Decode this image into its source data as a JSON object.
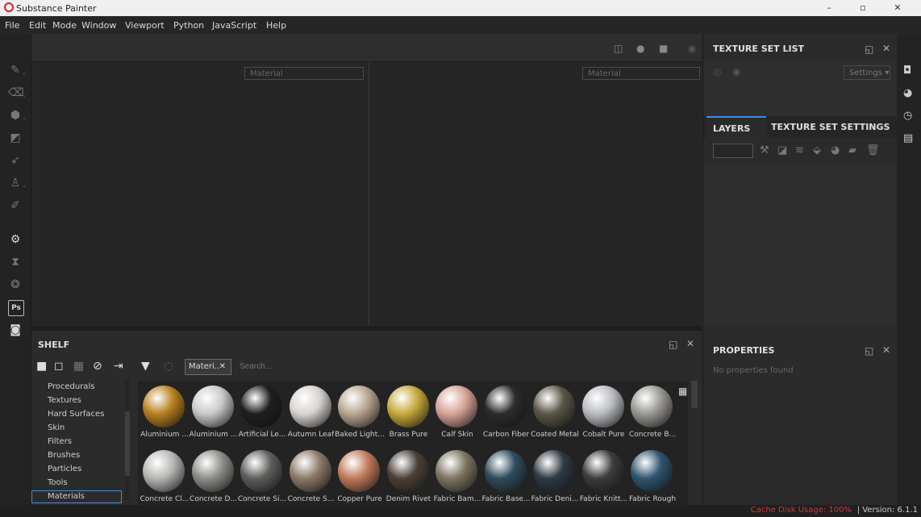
{
  "window": {
    "title": "Substance Painter",
    "controls": [
      "–",
      "▫",
      "✕"
    ]
  },
  "menubar": [
    "File",
    "Edit",
    "Mode",
    "Window",
    "Viewport",
    "Python",
    "JavaScript",
    "Help"
  ],
  "viewport": {
    "left_placeholder": "Material",
    "right_placeholder": "Material"
  },
  "shelf": {
    "title": "SHELF",
    "tag": "Materi..",
    "tag_close": "✕",
    "search_placeholder": "Search...",
    "categories": [
      "Procedurals",
      "Textures",
      "Hard Surfaces",
      "Skin",
      "Filters",
      "Brushes",
      "Particles",
      "Tools",
      "Materials"
    ],
    "selected_category": "Materials",
    "materials_row1": [
      {
        "label": "Aluminium ...",
        "color": "#b8801f"
      },
      {
        "label": "Aluminium ...",
        "color": "#c9c9c9"
      },
      {
        "label": "Artificial Le...",
        "color": "#1e1e1e"
      },
      {
        "label": "Autumn Leaf",
        "color": "#d8d3cf"
      },
      {
        "label": "Baked Light...",
        "color": "#b7a690"
      },
      {
        "label": "Brass Pure",
        "color": "#c7a93a"
      },
      {
        "label": "Calf Skin",
        "color": "#d6a396"
      },
      {
        "label": "Carbon Fiber",
        "color": "#2c2c2c"
      },
      {
        "label": "Coated Metal",
        "color": "#5a5646"
      },
      {
        "label": "Cobalt Pure",
        "color": "#b9bcc0"
      },
      {
        "label": "Concrete B...",
        "color": "#9a9893"
      }
    ],
    "materials_row2": [
      {
        "label": "Concrete Cl...",
        "color": "#b7b7b5"
      },
      {
        "label": "Concrete D...",
        "color": "#8e8d89"
      },
      {
        "label": "Concrete Si...",
        "color": "#5e5e5c"
      },
      {
        "label": "Concrete S...",
        "color": "#8c7a68"
      },
      {
        "label": "Copper Pure",
        "color": "#c07a5a"
      },
      {
        "label": "Denim Rivet",
        "color": "#4a4038"
      },
      {
        "label": "Fabric Bam...",
        "color": "#7d7560"
      },
      {
        "label": "Fabric Base...",
        "color": "#2f4c5c"
      },
      {
        "label": "Fabric Deni...",
        "color": "#2f3a44"
      },
      {
        "label": "Fabric Knitt...",
        "color": "#3c3c3c"
      },
      {
        "label": "Fabric Rough",
        "color": "#2f556f"
      }
    ]
  },
  "texture_set_list": {
    "title": "TEXTURE SET LIST",
    "settings_label": "Settings ▾"
  },
  "layers": {
    "tab_layers": "LAYERS",
    "tab_close": "✕",
    "tab_tss": "TEXTURE SET SETTINGS"
  },
  "properties": {
    "title": "PROPERTIES",
    "message": "No properties found"
  },
  "status": {
    "cache": "Cache Disk Usage:  100%",
    "version": "| Version: 6.1.1"
  }
}
